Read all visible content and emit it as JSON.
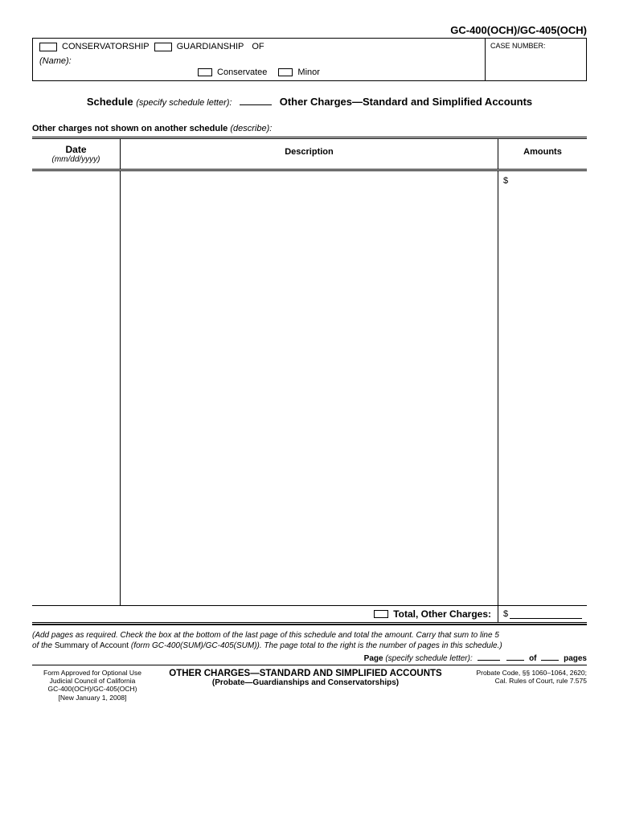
{
  "form_code": "GC-400(OCH)/GC-405(OCH)",
  "header": {
    "conservatorship": "CONSERVATORSHIP",
    "guardianship": "GUARDIANSHIP",
    "of": "OF",
    "name_label": "(Name):",
    "conservatee": "Conservatee",
    "minor": "Minor",
    "case_number": "CASE NUMBER:"
  },
  "title": {
    "schedule": "Schedule",
    "specify": "(specify schedule letter):",
    "other": "Other Charges—Standard and Simplified Accounts"
  },
  "subhead": {
    "main": "Other charges not shown on another schedule",
    "desc": "(describe):"
  },
  "table": {
    "date": "Date",
    "date_fmt": "(mm/dd/yyyy)",
    "description": "Description",
    "amounts": "Amounts",
    "dollar": "$"
  },
  "total": {
    "label": "Total, Other Charges:",
    "dollar": "$"
  },
  "note": {
    "line1": "(Add pages as required.  Check the box at the bottom of the last page of this schedule and total the amount. Carry that sum to line 5",
    "line2a": "of the ",
    "line2b": "Summary of Account ",
    "line2c": "(form GC-400(SUM)/GC-405(SUM)). The page total to the right is the number of pages in this schedule.)"
  },
  "page": {
    "page": "Page",
    "specify": "(specify schedule letter):",
    "of": "of",
    "pages": "pages"
  },
  "footer": {
    "left1": "Form Approved for Optional Use",
    "left2": "Judicial Council of California",
    "left3": "GC-400(OCH)/GC-405(OCH)",
    "left4": "[New January 1, 2008]",
    "mid1": "OTHER CHARGES—STANDARD AND SIMPLIFIED ACCOUNTS",
    "mid2": "(Probate—Guardianships and Conservatorships)",
    "right1": "Probate Code, §§ 1060–1064, 2620;",
    "right2": "Cal. Rules  of Court, rule 7.575"
  }
}
